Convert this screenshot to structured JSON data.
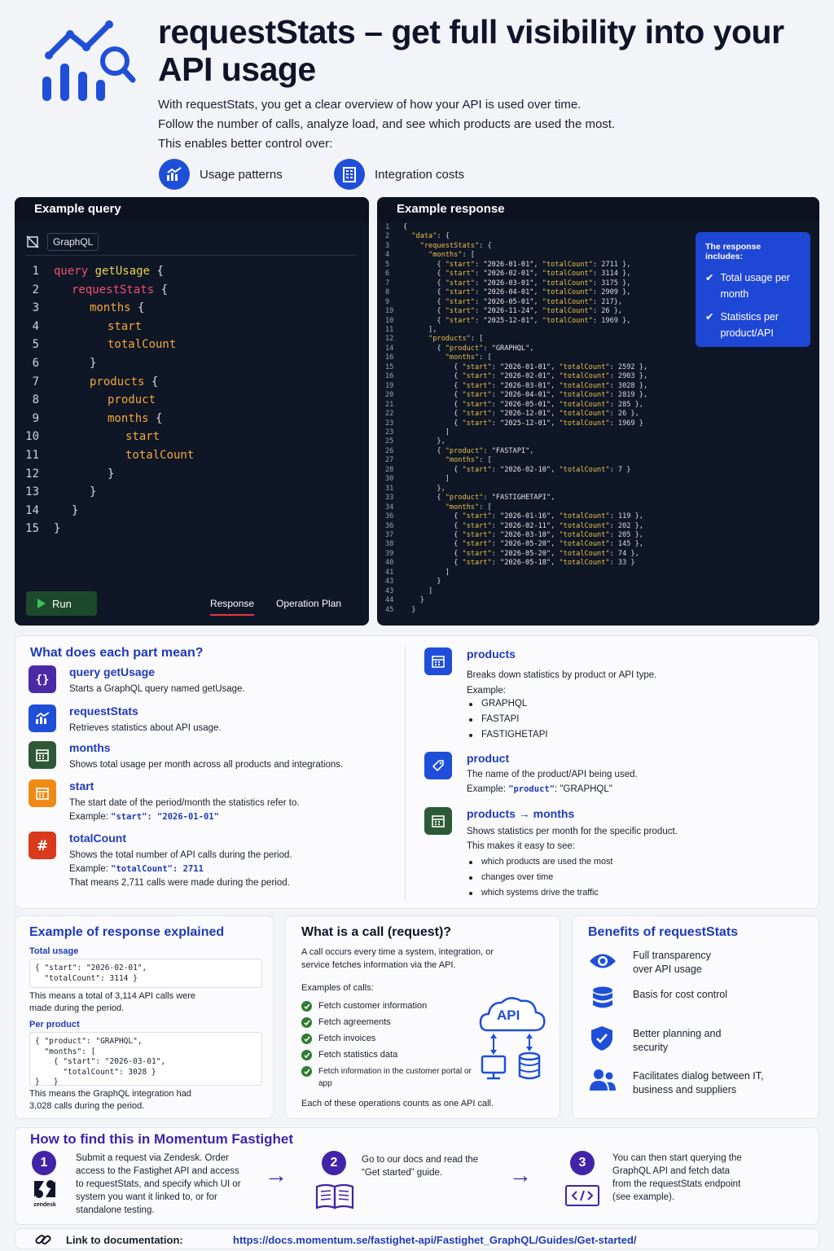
{
  "header": {
    "title": "requestStats – get full visibility into your API usage",
    "intro": [
      "With requestStats, you get a clear overview of how your API is used over time.",
      "Follow the number of calls, analyze load, and see which products are used the most.",
      "This enables better control over:"
    ],
    "pills": [
      {
        "label": "Usage patterns",
        "icon": "chart-icon"
      },
      {
        "label": "Integration costs",
        "icon": "building-icon"
      }
    ]
  },
  "query_panel": {
    "title": "Example query",
    "language": "GraphQL",
    "lines": [
      {
        "n": "1",
        "tokens": [
          {
            "t": "query ",
            "c": "kw"
          },
          {
            "t": "getUsage ",
            "c": "fn"
          },
          {
            "t": "{",
            "c": "br"
          }
        ],
        "indent": 0
      },
      {
        "n": "2",
        "tokens": [
          {
            "t": "requestStats ",
            "c": "kw"
          },
          {
            "t": "{",
            "c": "br"
          }
        ],
        "indent": 1
      },
      {
        "n": "3",
        "tokens": [
          {
            "t": "months ",
            "c": "fld"
          },
          {
            "t": "{",
            "c": "br"
          }
        ],
        "indent": 2
      },
      {
        "n": "4",
        "tokens": [
          {
            "t": "start",
            "c": "fld"
          }
        ],
        "indent": 3
      },
      {
        "n": "5",
        "tokens": [
          {
            "t": "totalCount",
            "c": "fld"
          }
        ],
        "indent": 3
      },
      {
        "n": "6",
        "tokens": [
          {
            "t": "}",
            "c": "br"
          }
        ],
        "indent": 2
      },
      {
        "n": "7",
        "tokens": [
          {
            "t": "products ",
            "c": "fld"
          },
          {
            "t": "{",
            "c": "br"
          }
        ],
        "indent": 2
      },
      {
        "n": "8",
        "tokens": [
          {
            "t": "product",
            "c": "fld"
          }
        ],
        "indent": 3
      },
      {
        "n": "9",
        "tokens": [
          {
            "t": "months ",
            "c": "fld"
          },
          {
            "t": "{",
            "c": "br"
          }
        ],
        "indent": 3
      },
      {
        "n": "10",
        "tokens": [
          {
            "t": "start",
            "c": "fld"
          }
        ],
        "indent": 4
      },
      {
        "n": "11",
        "tokens": [
          {
            "t": "totalCount",
            "c": "fld"
          }
        ],
        "indent": 4
      },
      {
        "n": "12",
        "tokens": [
          {
            "t": "}",
            "c": "br"
          }
        ],
        "indent": 3
      },
      {
        "n": "13",
        "tokens": [
          {
            "t": "}",
            "c": "br"
          }
        ],
        "indent": 2
      },
      {
        "n": "14",
        "tokens": [
          {
            "t": "}",
            "c": "br"
          }
        ],
        "indent": 1
      },
      {
        "n": "15",
        "tokens": [
          {
            "t": "}",
            "c": "br"
          }
        ],
        "indent": 0
      }
    ],
    "run_label": "Run",
    "tabs": [
      "Response",
      "Operation Plan"
    ]
  },
  "response_panel": {
    "title": "Example response",
    "lines": [
      [
        "1",
        "{"
      ],
      [
        "2",
        "  \"data\": {"
      ],
      [
        "3",
        "    \"requestStats\": {"
      ],
      [
        "4",
        "      \"months\": ["
      ],
      [
        "5",
        "        { \"start\": \"2026-01-01\", \"totalCount\": 2711 },"
      ],
      [
        "6",
        "        { \"start\": \"2026-02-01\", \"totalCount\": 3114 },"
      ],
      [
        "7",
        "        { \"start\": \"2026-03-01\", \"totalCount\": 3175 },"
      ],
      [
        "8",
        "        { \"start\": \"2026-04-01\", \"totalCount\": 2909 },"
      ],
      [
        "9",
        "        { \"start\": \"2026-05-01\", \"totalCount\": 217},"
      ],
      [
        "19",
        "        { \"start\": \"2026-11-24\", \"totalCount\": 26 },"
      ],
      [
        "10",
        "        { \"start\": \"2025-12-01\", \"totalCount\": 1969 },"
      ],
      [
        "11",
        "      ],"
      ],
      [
        "12",
        "      \"products\": ["
      ],
      [
        "14",
        "        { \"product\": \"GRAPHQL\","
      ],
      [
        "16",
        "          \"months\": ["
      ],
      [
        "15",
        "            { \"start\": \"2026-01-01\", \"totalCount\": 2592 },"
      ],
      [
        "16",
        "            { \"start\": \"2026-02-01\", \"totalCount\": 2903 },"
      ],
      [
        "19",
        "            { \"start\": \"2026-03-01\", \"totalCount\": 3028 },"
      ],
      [
        "20",
        "            { \"start\": \"2026-04-01\", \"totalCount\": 2819 },"
      ],
      [
        "21",
        "            { \"start\": \"2026-05-01\", \"totalCount\": 285 },"
      ],
      [
        "22",
        "            { \"start\": \"2026-12-01\", \"totalCount\": 26 },"
      ],
      [
        "23",
        "            { \"start\": \"2025-12-01\", \"totalCount\": 1969 }"
      ],
      [
        "23",
        "          ]"
      ],
      [
        "25",
        "        },"
      ],
      [
        "26",
        "        { \"product\": \"FASTAPI\","
      ],
      [
        "27",
        "          \"months\": ["
      ],
      [
        "28",
        "            { \"start\": \"2026-02-10\", \"totalCount\": 7 }"
      ],
      [
        "30",
        "          ]"
      ],
      [
        "31",
        "        },"
      ],
      [
        "33",
        "        { \"product\": \"FASTIGHETAPI\","
      ],
      [
        "34",
        "          \"months\": ["
      ],
      [
        "36",
        "            { \"start\": \"2026-01-16\", \"totalCount\": 119 },"
      ],
      [
        "36",
        "            { \"start\": \"2026-02-11\", \"totalCount\": 202 },"
      ],
      [
        "37",
        "            { \"start\": \"2026-03-10\", \"totalCount\": 205 },"
      ],
      [
        "38",
        "            { \"start\": \"2026-05-20\", \"totalCount\": 145 },"
      ],
      [
        "39",
        "            { \"start\": \"2026-05-20\", \"totalCount\": 74 },"
      ],
      [
        "40",
        "            { \"start\": \"2026-05-18\", \"totalCount\": 33 }"
      ],
      [
        "41",
        "          ]"
      ],
      [
        "43",
        "        }"
      ],
      [
        "43",
        "      ]"
      ],
      [
        "44",
        "    }"
      ],
      [
        "45",
        "  }"
      ]
    ],
    "callout": {
      "title": "The response includes:",
      "items": [
        "Total usage per month",
        "Statistics per product/API"
      ]
    }
  },
  "parts": {
    "title": "What does each part mean?",
    "left": [
      {
        "title": "query getUsage",
        "desc": "Starts a GraphQL query named getUsage.",
        "color": "#4b2aa8",
        "icon": "braces-icon"
      },
      {
        "title": "requestStats",
        "desc": "Retrieves statistics about API usage.",
        "color": "#1f4fd8",
        "icon": "chart-icon"
      },
      {
        "title": "months",
        "desc": "Shows total usage per month across all products and integrations.",
        "color": "#2d5a35",
        "icon": "calendar-icon"
      },
      {
        "title": "start",
        "desc": "The start date of the period/month the statistics refer to.",
        "example_label": "Example: ",
        "example_key": "\"start\"",
        "example_val": ": \"2026-01-01\"",
        "color": "#f08a16",
        "icon": "calendar-icon"
      },
      {
        "title": "totalCount",
        "desc": "Shows the total number of API calls during the period.",
        "example_label": "Example: ",
        "example_key": "\"totalCount\"",
        "example_val": ": 2711",
        "extra": "That means 2,711 calls were made during the period.",
        "color": "#d93a1c",
        "icon": "hash-icon"
      }
    ],
    "products": {
      "title": "products",
      "desc": "Breaks down statistics by product or API type.",
      "example": "Example:",
      "items": [
        "GRAPHQL",
        "FASTAPI",
        "FASTIGHETAPI"
      ]
    },
    "product": {
      "title": "product",
      "desc": "The name of the product/API being used.",
      "example_label": "Example: ",
      "example_key": "\"product\"",
      "example_val": ": \"GRAPHQL\""
    },
    "products_months": {
      "title": "products",
      "title2": "months",
      "desc": "Shows statistics per month for the specific product.",
      "desc2": "This makes it easy to see:",
      "items": [
        "which products are used the most",
        "changes over time",
        "which systems drive the traffic"
      ]
    }
  },
  "explained": {
    "title": "Example of response explained",
    "total_label": "Total usage",
    "total_code": [
      "{ \"start\": \"2026-02-01\",",
      "  \"totalCount\": 3114 }"
    ],
    "total_text": "This means a total of 3,114 API calls were made during the period.",
    "per_label": "Per product",
    "per_code": [
      "{ \"product\": \"GRAPHQL\",",
      "  \"months\": [",
      "    { \"start\": \"2026-03-01\",",
      "      \"totalCount\": 3028 }",
      "}   }"
    ],
    "per_text": "This means the GraphQL integration had 3,028 calls during the period."
  },
  "call": {
    "title": "What is a call (request)?",
    "desc": "A call occurs every time a system, integration, or service fetches information via the API.",
    "examples_label": "Examples of calls:",
    "items": [
      "Fetch customer information",
      "Fetch agreements",
      "Fetch invoices",
      "Fetch statistics data",
      "Fetch information in the customer portal or app"
    ],
    "api_label": "API",
    "footer": "Each of these operations counts as one API call."
  },
  "benefits": {
    "title": "Benefits of requestStats",
    "items": [
      {
        "text": "Full transparency over API usage",
        "icon": "eye-icon"
      },
      {
        "text": "Basis for cost control",
        "icon": "database-icon"
      },
      {
        "text": "Better planning and security",
        "icon": "shield-icon"
      },
      {
        "text": "Facilitates dialog between IT, business and suppliers",
        "icon": "users-icon"
      }
    ]
  },
  "howto": {
    "title": "How to find this in Momentum Fastighet",
    "steps": [
      {
        "num": "1",
        "text": "Submit a request via Zendesk. Order access to the Fastighet API and access to requestStats, and specify which UI or system you want it linked to, or for standalone testing.",
        "logo": "zendesk"
      },
      {
        "num": "2",
        "text": "Go to our docs and read the “Get started” guide."
      },
      {
        "num": "3",
        "text": "You can then start querying the GraphQL API and fetch data from the requestStats endpoint (see example)."
      }
    ]
  },
  "footer": {
    "label": "Link to documentation:",
    "url": "https://docs.momentum.se/fastighet-api/Fastighet_GraphQL/Guides/Get-started/"
  },
  "colors": {
    "accent": "#1f3ab8",
    "brand_blue": "#1f4fd8",
    "dark_panel": "#0f1626",
    "step": "#4124a8"
  }
}
